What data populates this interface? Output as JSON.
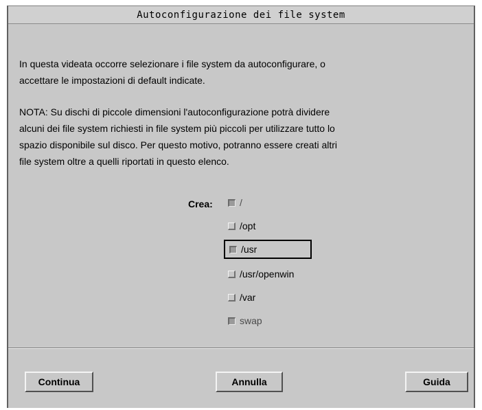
{
  "window": {
    "title": "Autoconfigurazione dei file system"
  },
  "intro": {
    "line1": "In questa videata occorre selezionare i file system da autoconfigurare, o",
    "line2": "accettare le impostazioni di default indicate."
  },
  "note": {
    "line1": "NOTA: Su dischi di piccole dimensioni l'autoconfigurazione potrà dividere",
    "line2": "alcuni dei file system richiesti in file system più piccoli per utilizzare tutto lo",
    "line3": "spazio disponibile sul disco. Per questo motivo, potranno essere creati altri",
    "line4": "file system oltre a quelli riportati in questo elenco."
  },
  "filesystems": {
    "label": "Crea:",
    "items": [
      {
        "name": "/",
        "checked": true
      },
      {
        "name": "/opt",
        "checked": false
      },
      {
        "name": "/usr",
        "checked": true
      },
      {
        "name": "/usr/openwin",
        "checked": false
      },
      {
        "name": "/var",
        "checked": false
      },
      {
        "name": "swap",
        "checked": true
      }
    ]
  },
  "buttons": {
    "continue": "Continua",
    "cancel": "Annulla",
    "help": "Guida"
  }
}
